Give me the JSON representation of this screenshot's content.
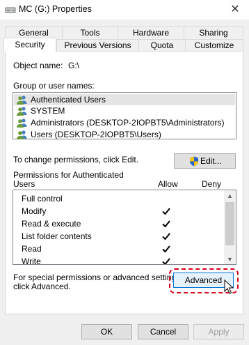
{
  "window": {
    "title": "MC (G:) Properties",
    "close_glyph": "✕"
  },
  "tabs_row1": [
    "General",
    "Tools",
    "Hardware",
    "Sharing"
  ],
  "tabs_row2": [
    "Security",
    "Previous Versions",
    "Quota",
    "Customize"
  ],
  "active_tab": "Security",
  "object_name": {
    "label": "Object name:",
    "value": "G:\\"
  },
  "group_section": {
    "label": "Group or user names:",
    "items": [
      {
        "name": "Authenticated Users",
        "icon": "users-group-icon",
        "selected": true
      },
      {
        "name": "SYSTEM",
        "icon": "users-group-icon",
        "selected": false
      },
      {
        "name": "Administrators (DESKTOP-2IOPBT5\\Administrators)",
        "icon": "users-group-icon",
        "selected": false
      },
      {
        "name": "Users (DESKTOP-2IOPBT5\\Users)",
        "icon": "users-group-icon",
        "selected": false
      }
    ]
  },
  "change_permissions": {
    "text": "To change permissions, click Edit.",
    "edit_label": "Edit...",
    "edit_icon": "uac-shield-icon"
  },
  "permissions": {
    "header_line1": "Permissions for Authenticated",
    "header_line2": "Users",
    "allow_label": "Allow",
    "deny_label": "Deny",
    "rows": [
      {
        "name": "Full control",
        "allow": false,
        "deny": false
      },
      {
        "name": "Modify",
        "allow": true,
        "deny": false
      },
      {
        "name": "Read & execute",
        "allow": true,
        "deny": false
      },
      {
        "name": "List folder contents",
        "allow": true,
        "deny": false
      },
      {
        "name": "Read",
        "allow": true,
        "deny": false
      },
      {
        "name": "Write",
        "allow": true,
        "deny": false
      }
    ]
  },
  "special": {
    "line1": "For special permissions or advanced settings,",
    "line2": "click Advanced.",
    "advanced_label": "Advanced"
  },
  "footer": {
    "ok": "OK",
    "cancel": "Cancel",
    "apply": "Apply"
  },
  "colors": {
    "highlight_outline": "#d9001b",
    "selected_row": "#e5e5e5",
    "panel_border": "#d9d9d9"
  }
}
